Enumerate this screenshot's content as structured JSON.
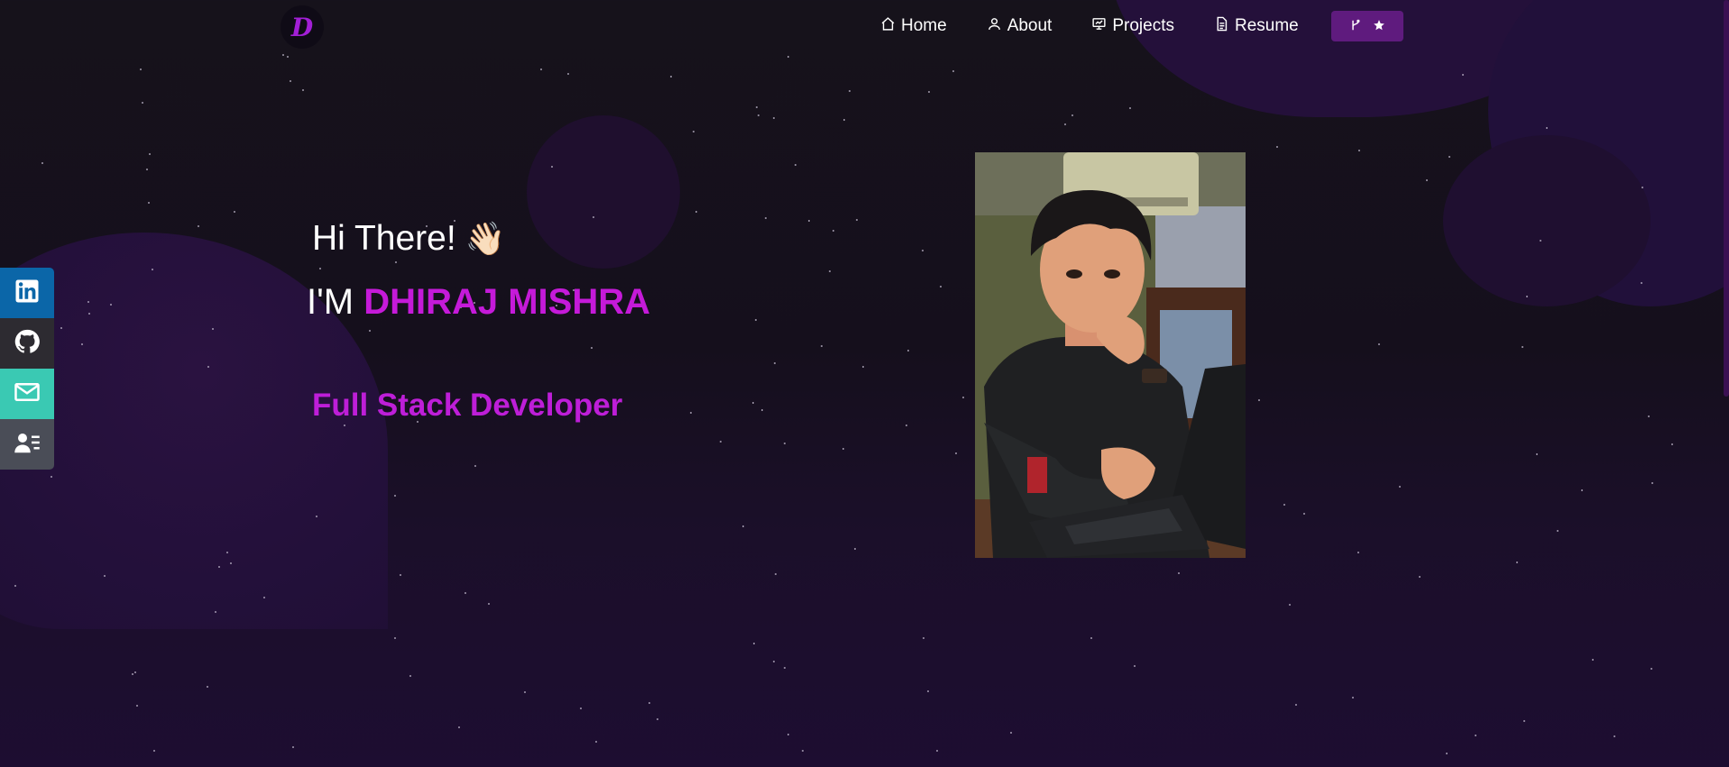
{
  "logo": {
    "letter": "D"
  },
  "nav": {
    "items": [
      {
        "label": "Home",
        "icon": "home-icon"
      },
      {
        "label": "About",
        "icon": "user-icon"
      },
      {
        "label": "Projects",
        "icon": "presentation-icon"
      },
      {
        "label": "Resume",
        "icon": "document-icon"
      }
    ],
    "fork_button": {
      "icons": [
        "git-fork-icon",
        "star-icon"
      ]
    }
  },
  "social": [
    {
      "icon": "linkedin-icon",
      "color": "#0b66a8"
    },
    {
      "icon": "github-icon",
      "color": "#2d2b31"
    },
    {
      "icon": "mail-icon",
      "color": "#3ac9b3"
    },
    {
      "icon": "contact-card-icon",
      "color": "#4a4d57"
    }
  ],
  "hero": {
    "greeting": "Hi There!",
    "wave_emoji": "👋🏻",
    "im_prefix": "I'M",
    "name": "DHIRAJ MISHRA",
    "role": "Full Stack Developer"
  },
  "colors": {
    "accent": "#c51ad9",
    "button": "#5f1b7e",
    "background": "#16121b"
  }
}
